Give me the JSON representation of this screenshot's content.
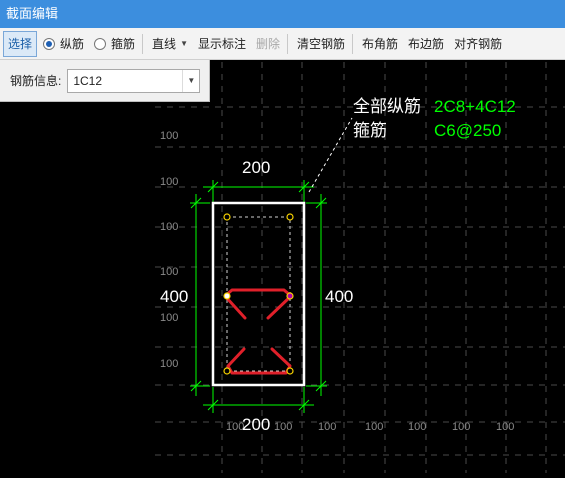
{
  "window": {
    "title": "截面编辑"
  },
  "toolbar": {
    "select": "选择",
    "longitudinal": "纵筋",
    "stirrup": "箍筋",
    "line_mode": "直线",
    "show_annotation": "显示标注",
    "delete": "删除",
    "clear_rebar": "清空钢筋",
    "corner_rebar": "布角筋",
    "side_rebar": "布边筋",
    "align_rebar": "对齐钢筋"
  },
  "rebar_info": {
    "label": "钢筋信息:",
    "value": "1C12"
  },
  "annotation": {
    "all_long_label": "全部纵筋",
    "all_long_value": "2C8+4C12",
    "stirrup_label": "箍筋",
    "stirrup_value": "C6@250"
  },
  "dimensions": {
    "top_width": "200",
    "bottom_width": "200",
    "left_height": "400",
    "right_height": "400"
  },
  "grid": {
    "label": "100"
  },
  "colors": {
    "title_bar": "#3c8ede",
    "dimension": "#00ff00",
    "value_text": "#00ff00",
    "section": "#ffffff",
    "rebar": "#e0202a",
    "grid": "#4a4a4a"
  }
}
